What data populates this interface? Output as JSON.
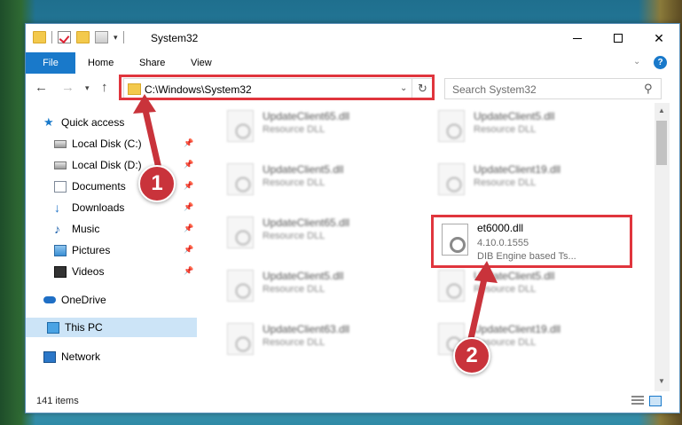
{
  "window": {
    "title": "System32"
  },
  "ribbon": {
    "tabs": [
      "File",
      "Home",
      "Share",
      "View"
    ]
  },
  "address": {
    "path": "C:\\Windows\\System32",
    "search_placeholder": "Search System32"
  },
  "sidebar": {
    "items": [
      {
        "label": "Quick access",
        "icon": "star-icon"
      },
      {
        "label": "Local Disk (C:)",
        "icon": "disk-icon"
      },
      {
        "label": "Local Disk (D:)",
        "icon": "disk-icon"
      },
      {
        "label": "Documents",
        "icon": "documents-icon"
      },
      {
        "label": "Downloads",
        "icon": "downloads-icon"
      },
      {
        "label": "Music",
        "icon": "music-icon"
      },
      {
        "label": "Pictures",
        "icon": "pictures-icon"
      },
      {
        "label": "Videos",
        "icon": "videos-icon"
      },
      {
        "label": "OneDrive",
        "icon": "onedrive-icon"
      },
      {
        "label": "This PC",
        "icon": "this-pc-icon"
      },
      {
        "label": "Network",
        "icon": "network-icon"
      }
    ]
  },
  "files": [
    {
      "name": "UpdateClient65.dll",
      "desc": "Resource DLL"
    },
    {
      "name": "UpdateClient5.dll",
      "desc": "Resource DLL"
    },
    {
      "name": "UpdateClient5.dll",
      "desc": "Resource DLL"
    },
    {
      "name": "UpdateClient19.dll",
      "desc": "Resource DLL"
    },
    {
      "name": "UpdateClient65.dll",
      "desc": "Resource DLL"
    },
    {
      "name": "UpdateClient5.dll",
      "desc": "Resource DLL"
    },
    {
      "name": "UpdateClient5.dll",
      "desc": "Resource DLL"
    },
    {
      "name": "UpdateClient63.dll",
      "desc": "Resource DLL"
    },
    {
      "name": "UpdateClient19.dll",
      "desc": "Resource DLL"
    }
  ],
  "target_file": {
    "name": "et6000.dll",
    "version": "4.10.0.1555",
    "desc": "DIB Engine based Ts..."
  },
  "status": {
    "items_count": "141 items"
  },
  "callouts": {
    "step1": "1",
    "step2": "2"
  },
  "colors": {
    "accent": "#1979ca",
    "highlight": "#e0353d",
    "callout": "#c9333b"
  }
}
